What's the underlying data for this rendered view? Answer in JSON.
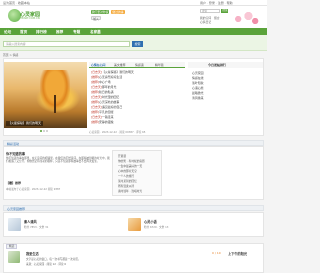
{
  "topbar": {
    "left": "设为首页 · 收藏本站",
    "right": "用户 · 登录 · 注册 · 帮助"
  },
  "header": {
    "logo_text": "心灵家园",
    "logo_url": "HEART.COM.CN",
    "btn_post": "我们要对你说",
    "btn_read": "做过的事",
    "btn_join": "加入",
    "search_placeholder": "搜索",
    "search_button": "搜索",
    "links": [
      "我的空间",
      "心情日记",
      "留言"
    ]
  },
  "nav": {
    "items": [
      "论坛",
      "首页",
      "排行榜",
      "推荐",
      "专题",
      "名家墨"
    ]
  },
  "search": {
    "placeholder": "请输入搜索内容",
    "button": "搜索"
  },
  "breadcrumb": "首页 > 情感",
  "feature": {
    "caption": "【火星探秘】我们的明天",
    "tabs": [
      "心情在心间",
      "美文推荐",
      "情感语",
      "精华篇"
    ],
    "list": [
      {
        "tag": "[日志天]",
        "text": "【火星探秘】我们的明天"
      },
      {
        "tag": "[推荐]",
        "text": "心无旁骛好好生活"
      },
      {
        "tag": "[推荐]",
        "text": "中心广场"
      },
      {
        "tag": "[日志天]",
        "text": "那年的月光"
      },
      {
        "tag": "[推荐]",
        "text": "秋日的私语"
      },
      {
        "tag": "[日志天]",
        "text": "时光里的回忆"
      },
      {
        "tag": "[推荐]",
        "text": "心灵深处的故事"
      },
      {
        "tag": "[日志天]",
        "text": "遇见最好的自己"
      },
      {
        "tag": "[推荐]",
        "text": "平凡的温暖"
      },
      {
        "tag": "[日志天]",
        "text": "一路走来"
      },
      {
        "tag": "[推荐]",
        "text": "安静的夜晚"
      }
    ],
    "meta": "心灵家园 · 2023-12-22 · 阅读 09387 · 评论 65",
    "right_title": "今日发帖排行",
    "right_list": [
      "心灵家园",
      "情感在线",
      "落叶知秋",
      "心语心愿",
      "晨曦微光",
      "清风徐来"
    ]
  },
  "article": {
    "section_title": "精彩活动",
    "title": "你不知道的事",
    "body": "你不知道的事在那里，在无意间的相遇里，在我们的不经意间，在那些被忽略的时光中，我们相遇了又分开，却依然记得当初的模样，只是不知道那些故事会不会再次发生。",
    "sub_title": "【赠】推荐",
    "foot": "本帖发布于心灵家园 · 2023-12-22 阅读 9387",
    "side_list": [
      "开篇语",
      "你的笑 · 有时候的喜怒",
      "一生中最美好的一天",
      "心中的那片天空",
      "一个人的旅行",
      "某时某刻的回忆",
      "所有温柔以待",
      "素时锦年 · 浅唱时光"
    ]
  },
  "cards": {
    "section_title": "心灵家园推荐",
    "items": [
      {
        "title": "素人清风",
        "meta": "粉丝 7853 · 文章 31"
      },
      {
        "title": "心灵小语",
        "meta": "粉丝 6720 · 文章 13"
      }
    ]
  },
  "bottom": {
    "chip": "精选",
    "title": "我爱生活",
    "text1": "文字是心灵的窗口，每一次书写都是一次对话。",
    "text2": "来源：心灵家园 · 阅读 12 · 评论 6",
    "price": "0 / 10",
    "right_title": "上下午的阳光"
  }
}
